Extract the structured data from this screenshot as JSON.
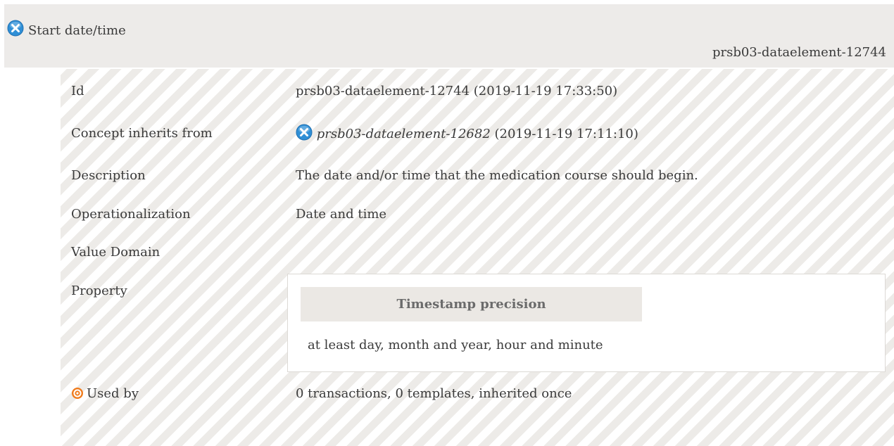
{
  "header": {
    "title": "Start date/time",
    "id": "prsb03-dataelement-12744"
  },
  "rows": {
    "id": {
      "label": "Id",
      "value": "prsb03-dataelement-12744 (2019-11-19 17:33:50)"
    },
    "inherits": {
      "label": "Concept inherits from",
      "link": "prsb03-dataelement-12682",
      "suffix": " (2019-11-19 17:11:10)"
    },
    "description": {
      "label": "Description",
      "value": "The date and/or time that the medication course should begin."
    },
    "operationalization": {
      "label": "Operationalization",
      "value": "Date and time"
    },
    "value_domain": {
      "label": "Value Domain"
    },
    "property": {
      "label": "Property",
      "heading": "Timestamp precision",
      "value": "at least day, month and year, hour and minute"
    },
    "used_by": {
      "label": "Used by",
      "value": "0 transactions, 0 templates, inherited once"
    }
  },
  "colors": {
    "header_bg": "#edebe9",
    "stripe": "#edebe8",
    "icon_blue": "#2f8fd6",
    "target_orange": "#f07a1a"
  },
  "icons": {
    "concept": "concept-item-icon",
    "used_by": "target-icon"
  }
}
